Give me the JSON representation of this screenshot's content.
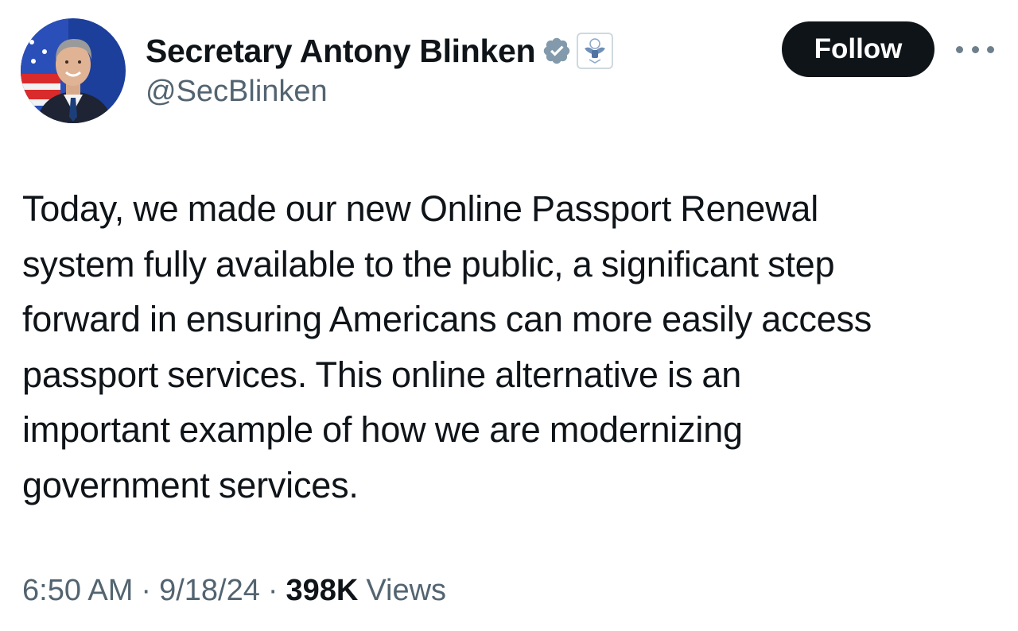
{
  "author": {
    "display_name": "Secretary Antony Blinken",
    "handle": "@SecBlinken",
    "avatar_icon": "profile-photo",
    "verified_icon": "verified-badge-icon",
    "affiliate_icon": "us-state-department-seal-icon",
    "verified_color": "#829aab"
  },
  "actions": {
    "follow_label": "Follow",
    "more_icon": "more-options-icon"
  },
  "tweet": {
    "text_lines": [
      "Today, we made our new Online Passport Renewal",
      "system fully available to the public, a significant step",
      "forward in ensuring Americans can more easily access",
      "passport services. This online alternative is an",
      "important example of how we are modernizing",
      "government services."
    ]
  },
  "meta": {
    "time": "6:50 AM",
    "separator": "·",
    "date": "9/18/24",
    "views_count": "398K",
    "views_label": "Views"
  }
}
